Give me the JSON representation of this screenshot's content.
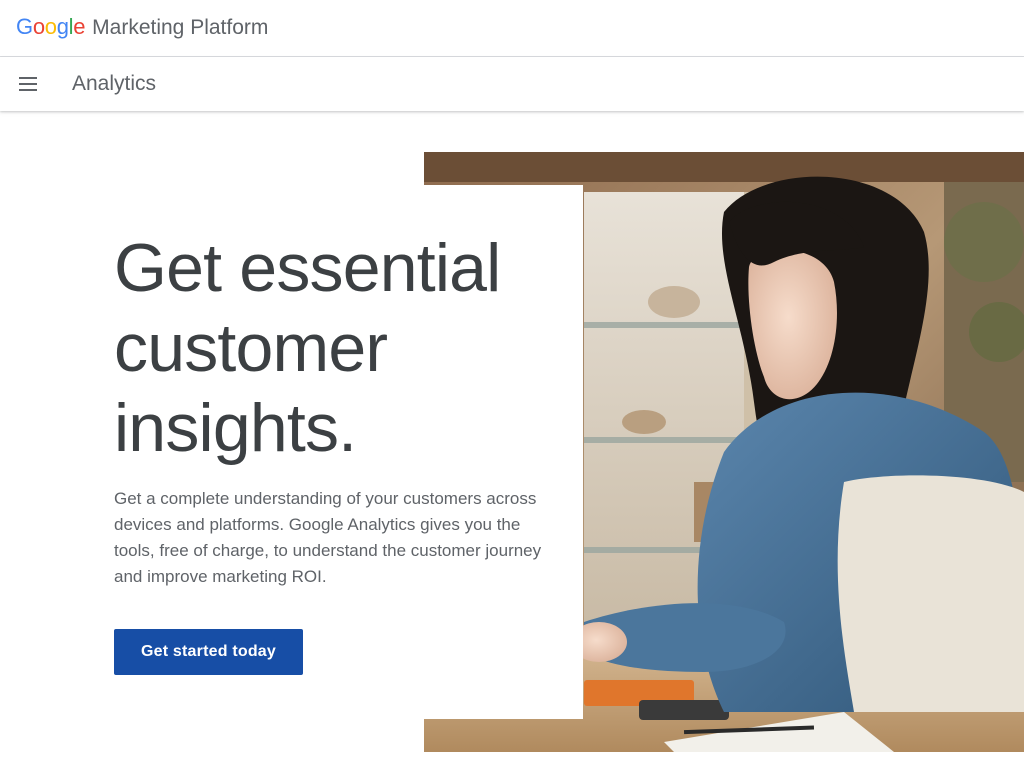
{
  "header": {
    "logo": {
      "letters": [
        "G",
        "o",
        "o",
        "g",
        "l",
        "e"
      ],
      "colors": [
        "#4285f4",
        "#ea4335",
        "#fbbc05",
        "#4285f4",
        "#34a853",
        "#ea4335"
      ]
    },
    "platform_label": "Marketing Platform"
  },
  "subnav": {
    "menu_icon": "hamburger-menu-icon",
    "title": "Analytics"
  },
  "hero": {
    "headline_line1": "Get essential",
    "headline_line2": "customer",
    "headline_line3": "insights.",
    "description": "Get a complete understanding of your customers across devices and platforms. Google Analytics gives you the tools, free of charge, to understand the customer journey and improve marketing ROI.",
    "cta_label": "Get started today",
    "cta_color": "#174ea6"
  }
}
